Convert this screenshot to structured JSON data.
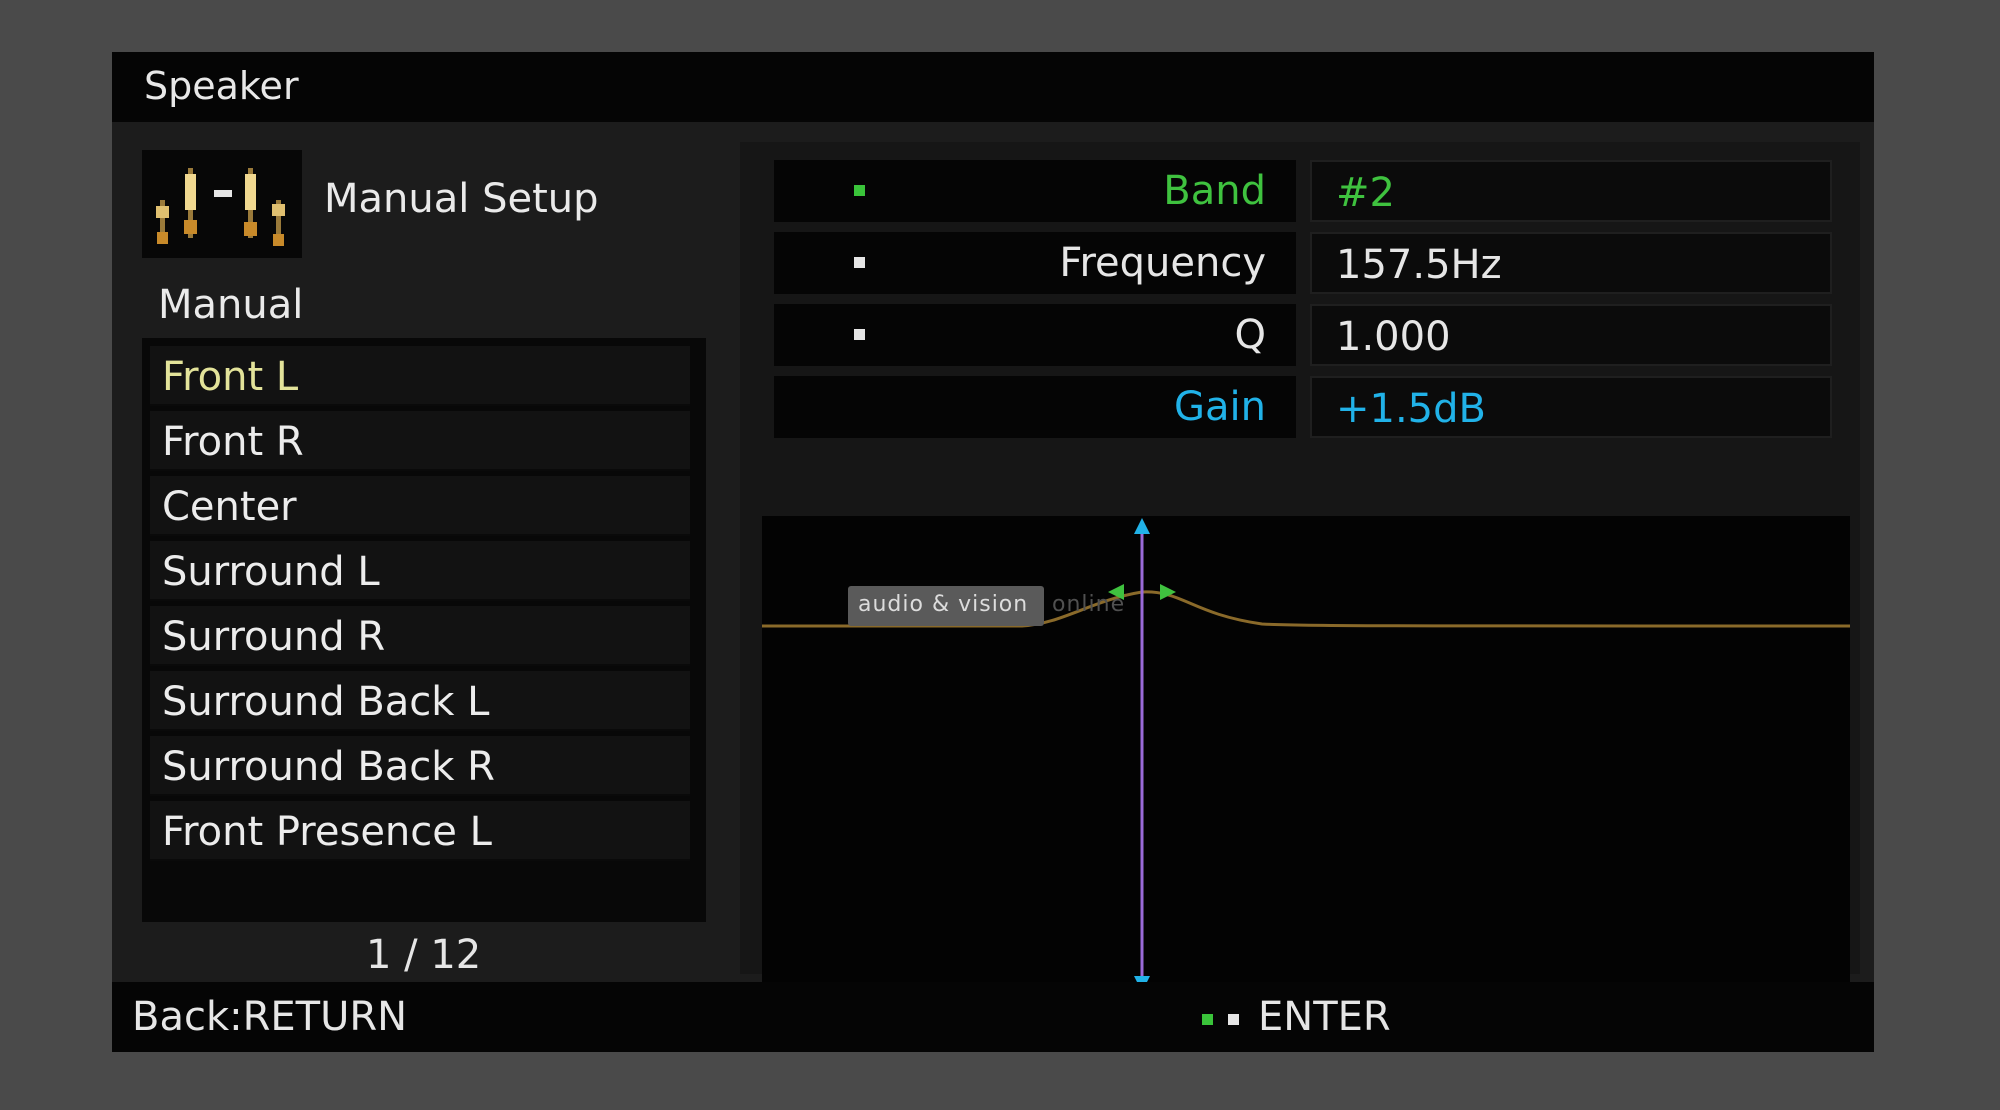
{
  "window": {
    "title": "Speaker"
  },
  "setup": {
    "label": "Manual Setup",
    "icon": "equalizer-sliders-icon"
  },
  "mode": {
    "label": "Manual"
  },
  "speakers": {
    "items": [
      {
        "label": "Front L",
        "selected": true
      },
      {
        "label": "Front R",
        "selected": false
      },
      {
        "label": "Center",
        "selected": false
      },
      {
        "label": "Surround L",
        "selected": false
      },
      {
        "label": "Surround R",
        "selected": false
      },
      {
        "label": "Surround Back L",
        "selected": false
      },
      {
        "label": "Surround Back R",
        "selected": false
      },
      {
        "label": "Front Presence L",
        "selected": false
      }
    ],
    "page": "1 / 12"
  },
  "params": {
    "band": {
      "label": "Band",
      "value": "#2"
    },
    "frequency": {
      "label": "Frequency",
      "value": "157.5Hz"
    },
    "q": {
      "label": "Q",
      "value": "1.000"
    },
    "gain": {
      "label": "Gain",
      "value": "+1.5dB"
    }
  },
  "watermark": {
    "text": "audio & vision",
    "tail": "online"
  },
  "footer": {
    "back_hint": "Back:RETURN",
    "enter_label": "ENTER"
  },
  "colors": {
    "selected_item": "#e3e39a",
    "active_param": "#3fc23f",
    "gain_param": "#21b2e8",
    "curve": "#8a6a2a",
    "cursor_line": "#9a6ad8",
    "cursor_arrow": "#21b2e8"
  }
}
